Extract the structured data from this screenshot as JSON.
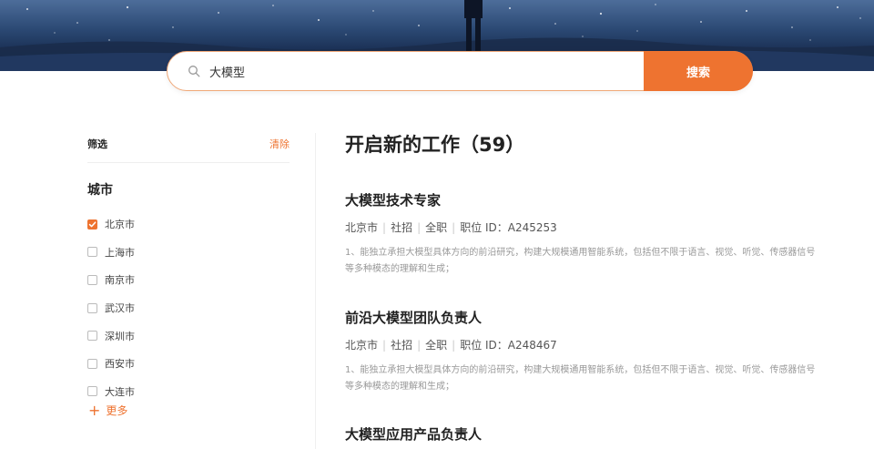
{
  "search": {
    "query": "大模型",
    "button_label": "搜索"
  },
  "filter": {
    "title": "筛选",
    "clear_label": "清除",
    "city_heading": "城市",
    "cities": [
      {
        "label": "北京市",
        "checked": true
      },
      {
        "label": "上海市",
        "checked": false
      },
      {
        "label": "南京市",
        "checked": false
      },
      {
        "label": "武汉市",
        "checked": false
      },
      {
        "label": "深圳市",
        "checked": false
      },
      {
        "label": "西安市",
        "checked": false
      },
      {
        "label": "大连市",
        "checked": false
      }
    ],
    "more_icon": "plus-icon",
    "more_label": "更多"
  },
  "results": {
    "title": "开启新的工作（59）",
    "separator": "|",
    "jobs": [
      {
        "title": "大模型技术专家",
        "city": "北京市",
        "type": "社招",
        "schedule": "全职",
        "id_label": "职位 ID：A245253",
        "desc": "1、能独立承担大模型具体方向的前沿研究，构建大规模通用智能系统，包括但不限于语言、视觉、听觉、传感器信号等多种模态的理解和生成；"
      },
      {
        "title": "前沿大模型团队负责人",
        "city": "北京市",
        "type": "社招",
        "schedule": "全职",
        "id_label": "职位 ID：A248467",
        "desc": "1、能独立承担大模型具体方向的前沿研究，构建大规模通用智能系统，包括但不限于语言、视觉、听觉、传感器信号等多种模态的理解和生成；"
      },
      {
        "title": "大模型应用产品负责人"
      }
    ]
  },
  "colors": {
    "accent": "#ee7330",
    "hero_sky": "#2c4a75"
  }
}
